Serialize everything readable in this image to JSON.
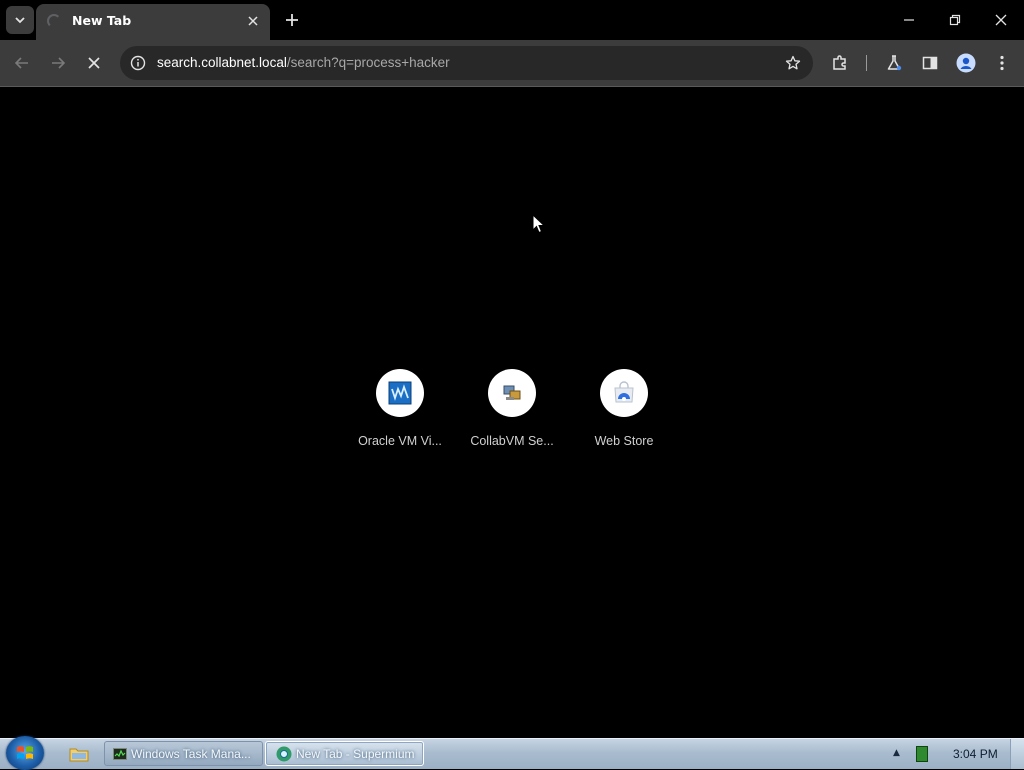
{
  "browser": {
    "tab": {
      "title": "New Tab"
    },
    "address_bar": {
      "host": "search.collabnet.local",
      "path": "/search?q=process+hacker"
    }
  },
  "new_tab_page": {
    "shortcuts": [
      {
        "label": "Oracle VM Vi...",
        "icon": "virtualbox-icon"
      },
      {
        "label": "CollabVM Se...",
        "icon": "collabvm-icon"
      },
      {
        "label": "Web Store",
        "icon": "web-store-icon"
      }
    ]
  },
  "taskbar": {
    "tasks": [
      {
        "label": "Windows Task Mana...",
        "icon": "task-manager-icon"
      },
      {
        "label": "New Tab - Supermium",
        "icon": "supermium-icon",
        "active": true
      }
    ],
    "clock": "3:04 PM"
  },
  "colors": {
    "page_background": "#000000",
    "toolbar": "#3c3c3c",
    "omnibox": "#282828",
    "taskbar": "#a9bccf"
  }
}
